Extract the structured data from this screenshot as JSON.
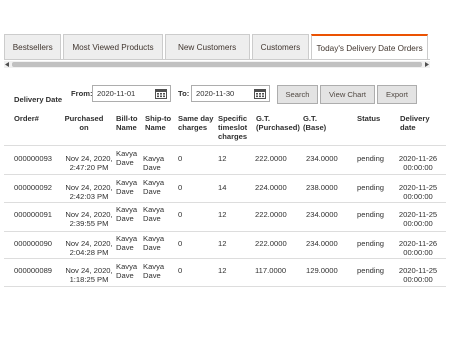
{
  "tabs": [
    {
      "label": "Bestsellers",
      "active": false
    },
    {
      "label": "Most Viewed Products",
      "active": false
    },
    {
      "label": "New Customers",
      "active": false
    },
    {
      "label": "Customers",
      "active": false
    },
    {
      "label": "Today's Delivery Date Orders",
      "active": true
    }
  ],
  "filter": {
    "delivery_date_label": "Delivery Date",
    "from_label": "From:",
    "from_value": "2020-11-01",
    "to_label": "To:",
    "to_value": "2020-11-30",
    "search_label": "Search",
    "view_chart_label": "View Chart",
    "export_label": "Export"
  },
  "table": {
    "columns": {
      "order": "Order#",
      "purchased_on": [
        "Purchased",
        "on"
      ],
      "bill_to": [
        "Bill-to",
        "Name"
      ],
      "ship_to": [
        "Ship-to",
        "Name"
      ],
      "same_day": [
        "Same day",
        "charges"
      ],
      "timeslot": [
        "Specific",
        "timeslot",
        "charges"
      ],
      "gt_purchased": [
        "G.T.",
        "(Purchased)"
      ],
      "gt_base": [
        "G.T.",
        "(Base)"
      ],
      "status": "Status",
      "delivery_date": [
        "Delivery",
        "date"
      ]
    },
    "rows": [
      {
        "order": "000000093",
        "purchased": [
          "Nov 24, 2020,",
          "2:47:20 PM"
        ],
        "bill": [
          "Kavya",
          "Dave"
        ],
        "ship": [
          "Kavya",
          "Dave"
        ],
        "same_day": "0",
        "timeslot": "12",
        "gt_purchased": "222.0000",
        "gt_base": "234.0000",
        "status": "pending",
        "delivery": [
          "2020-11-26",
          "00:00:00"
        ]
      },
      {
        "order": "000000092",
        "purchased": [
          "Nov 24, 2020,",
          "2:42:03 PM"
        ],
        "bill": [
          "Kavya",
          "Dave"
        ],
        "ship": [
          "Kavya",
          "Dave"
        ],
        "same_day": "0",
        "timeslot": "14",
        "gt_purchased": "224.0000",
        "gt_base": "238.0000",
        "status": "pending",
        "delivery": [
          "2020-11-25",
          "00:00:00"
        ]
      },
      {
        "order": "000000091",
        "purchased": [
          "Nov 24, 2020,",
          "2:39:55 PM"
        ],
        "bill": [
          "Kavya",
          "Dave"
        ],
        "ship": [
          "Kavya",
          "Dave"
        ],
        "same_day": "0",
        "timeslot": "12",
        "gt_purchased": "222.0000",
        "gt_base": "234.0000",
        "status": "pending",
        "delivery": [
          "2020-11-25",
          "00:00:00"
        ]
      },
      {
        "order": "000000090",
        "purchased": [
          "Nov 24, 2020,",
          "2:04:28 PM"
        ],
        "bill": [
          "Kavya",
          "Dave"
        ],
        "ship": [
          "Kavya",
          "Dave"
        ],
        "same_day": "0",
        "timeslot": "12",
        "gt_purchased": "222.0000",
        "gt_base": "234.0000",
        "status": "pending",
        "delivery": [
          "2020-11-26",
          "00:00:00"
        ]
      },
      {
        "order": "000000089",
        "purchased": [
          "Nov 24, 2020,",
          "1:18:25 PM"
        ],
        "bill": [
          "Kavya",
          "Dave"
        ],
        "ship": [
          "Kavya",
          "Dave"
        ],
        "same_day": "0",
        "timeslot": "12",
        "gt_purchased": "117.0000",
        "gt_base": "129.0000",
        "status": "pending",
        "delivery": [
          "2020-11-25",
          "00:00:00"
        ]
      }
    ]
  },
  "colors": {
    "active_tab_accent": "#eb5202",
    "tab_bg": "#eeeeee",
    "button_bg": "#e3e3e3"
  }
}
